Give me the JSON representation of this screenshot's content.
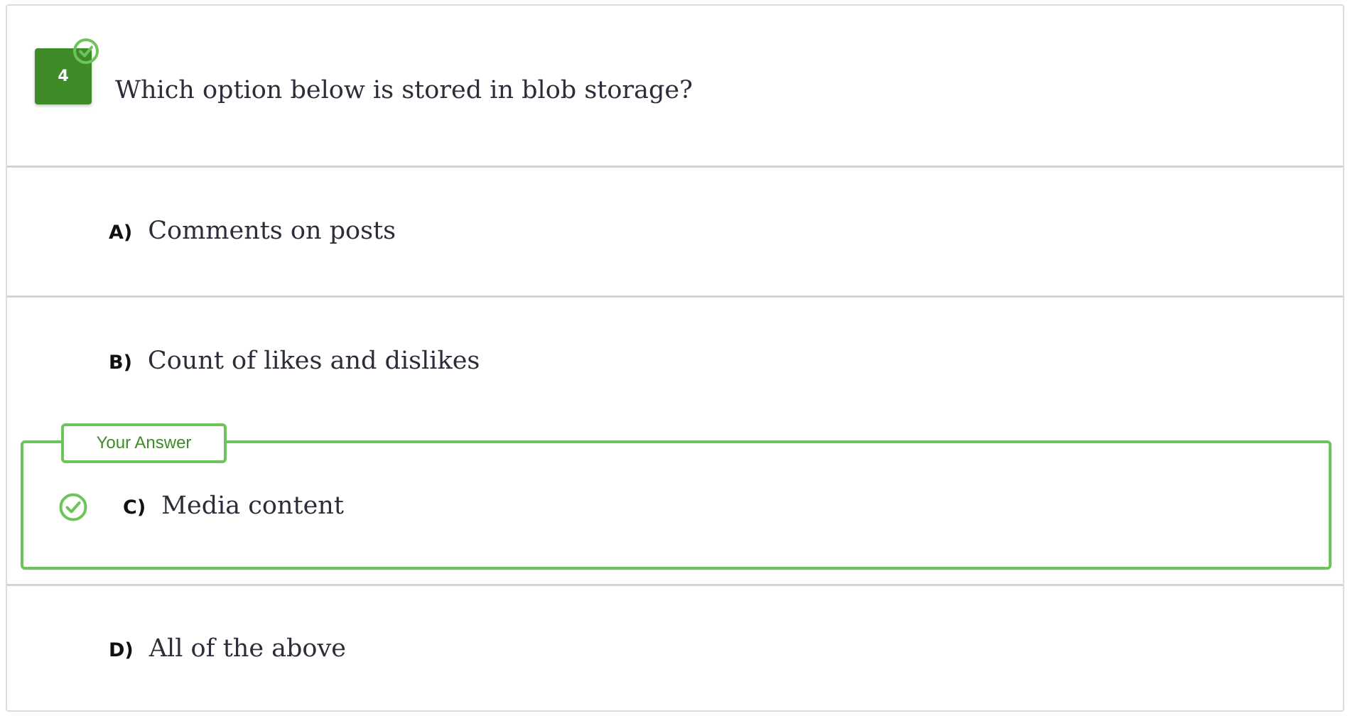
{
  "question": {
    "number": "4",
    "text": "Which option below is stored in blob storage?"
  },
  "options": [
    {
      "letter": "A)",
      "text": "Comments on posts"
    },
    {
      "letter": "B)",
      "text": "Count of likes and dislikes"
    },
    {
      "letter": "C)",
      "text": "Media content"
    },
    {
      "letter": "D)",
      "text": "All of the above"
    }
  ],
  "selected_answer": {
    "label": "Your Answer",
    "letter": "C)",
    "is_correct": true
  },
  "colors": {
    "accent_green": "#3e8b27",
    "border_green": "#6cc45a",
    "text": "#2d2d3a"
  },
  "icons": {
    "question_status": "check-circle-icon",
    "answer_status": "check-circle-icon"
  }
}
